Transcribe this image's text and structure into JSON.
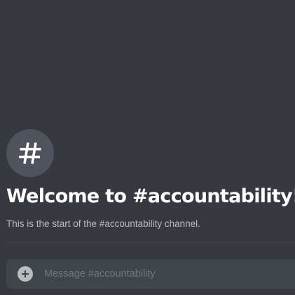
{
  "channel": {
    "icon": "hash-icon",
    "welcome_title": "Welcome to #accountability!",
    "welcome_subtitle": "This is the start of the #accountability channel."
  },
  "composer": {
    "attach_icon": "plus-circle-icon",
    "placeholder": "Message #accountability",
    "value": ""
  },
  "colors": {
    "background": "#36393f",
    "hash_circle": "#4f545c",
    "title": "#ffffff",
    "subtitle": "#b9bbbe",
    "composer_bg": "#40444b",
    "placeholder": "#72767d"
  }
}
